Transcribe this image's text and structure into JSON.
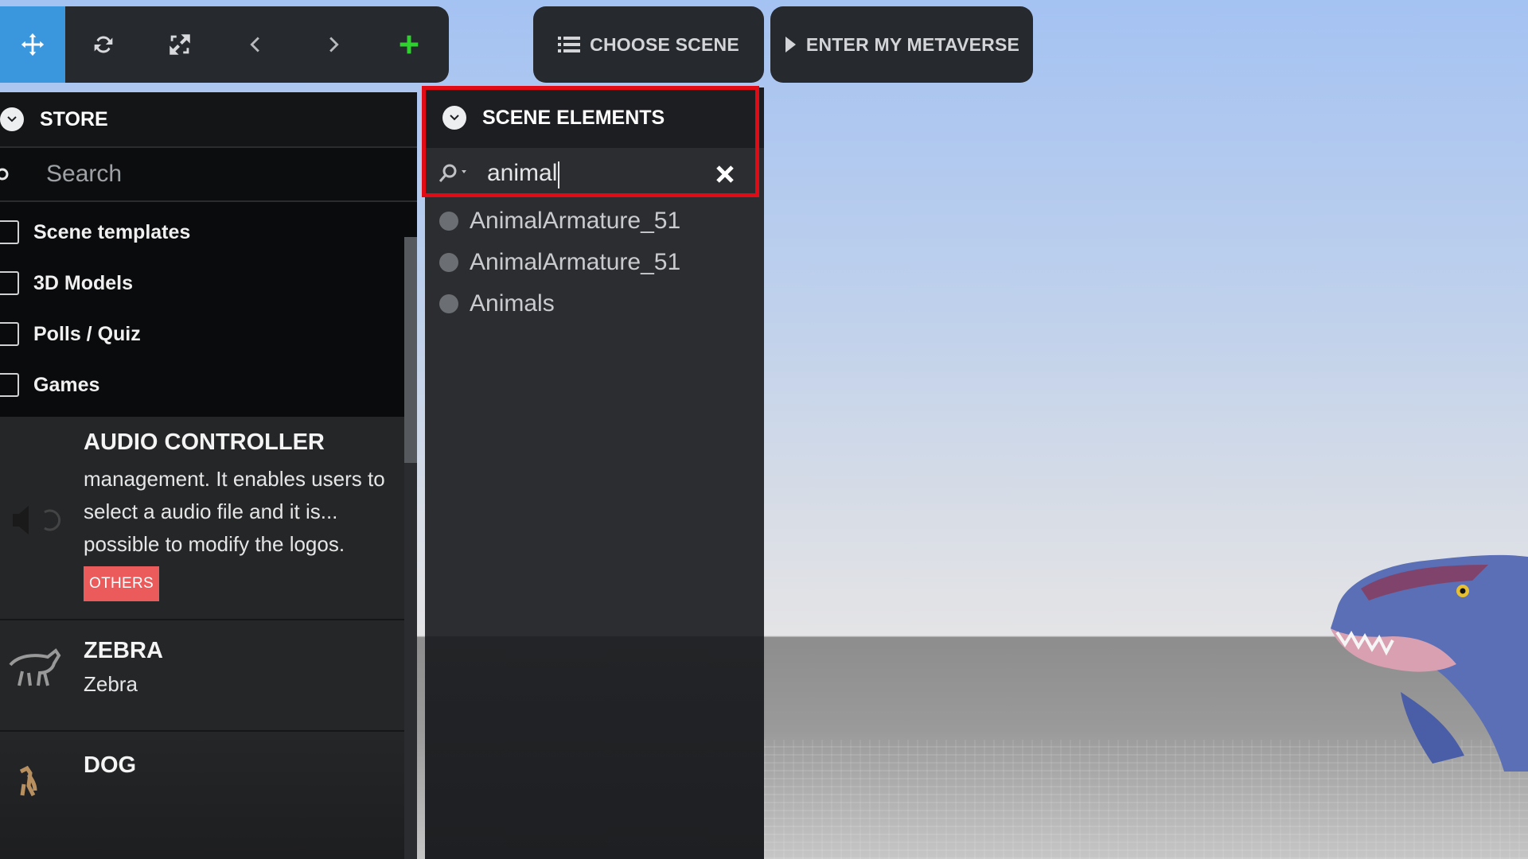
{
  "toolbar": {
    "tools": [
      {
        "name": "move-tool",
        "icon": "move-arrows-icon"
      },
      {
        "name": "rotate-tool",
        "icon": "rotate-icon"
      },
      {
        "name": "scale-tool",
        "icon": "scale-icon"
      },
      {
        "name": "undo-tool",
        "icon": "chevron-left-icon"
      },
      {
        "name": "redo-tool",
        "icon": "chevron-right-icon"
      },
      {
        "name": "add-tool",
        "icon": "plus-icon"
      }
    ],
    "choose_scene_label": "CHOOSE SCENE",
    "enter_metaverse_label": "ENTER MY METAVERSE"
  },
  "store": {
    "title": "STORE",
    "search_placeholder": "Search",
    "categories": [
      "Scene templates",
      "3D Models",
      "Polls / Quiz",
      "Games"
    ],
    "cards": [
      {
        "title": "AUDIO CONTROLLER",
        "description": "management. It enables users to select a audio file and it is... possible to modify the logos.",
        "tag": "OTHERS"
      },
      {
        "title": "ZEBRA",
        "subtitle": "Zebra"
      },
      {
        "title": "DOG"
      }
    ]
  },
  "scene_elements": {
    "title": "SCENE ELEMENTS",
    "search_value": "animal",
    "items": [
      "AnimalArmature_51",
      "AnimalArmature_51",
      "Animals"
    ]
  },
  "colors": {
    "accent": "#3a96dd",
    "tag": "#ec5b5b",
    "highlight": "#e00b14",
    "add": "#2fd12f"
  }
}
